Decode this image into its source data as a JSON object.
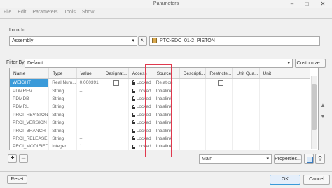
{
  "window": {
    "title": "Parameters",
    "minimize": "–",
    "maximize": "□",
    "close": "✕"
  },
  "menu": [
    "File",
    "Edit",
    "Parameters",
    "Tools",
    "Show"
  ],
  "look_in": {
    "label": "Look In",
    "dropdown_value": "Assembly",
    "selected_path": "PTC-EDC_01-2_PISTON"
  },
  "filter": {
    "label": "Filter By",
    "value": "Default",
    "customize_label": "Customize..."
  },
  "table": {
    "columns": [
      "Name",
      "Type",
      "Value",
      "Designat...",
      "Access",
      "Source",
      "Descripti...",
      "Restricte...",
      "Unit Qua...",
      "Unit"
    ],
    "rows": [
      {
        "name": "WEIGHT",
        "type": "Real Num...",
        "value": "0.000391",
        "access": "Locked",
        "source": "Relation",
        "selected": true
      },
      {
        "name": "PDMREV",
        "type": "String",
        "value": "–",
        "access": "Locked",
        "source": "Intralink"
      },
      {
        "name": "PDMDB",
        "type": "String",
        "value": "",
        "access": "Locked",
        "source": "Intralink"
      },
      {
        "name": "PDMRL",
        "type": "String",
        "value": "",
        "access": "Locked",
        "source": "Intralink"
      },
      {
        "name": "PROI_REVISION",
        "type": "String",
        "value": "",
        "access": "Locked",
        "source": "Intralink"
      },
      {
        "name": "PROI_VERSION",
        "type": "String",
        "value": "+",
        "access": "Locked",
        "source": "Intralink"
      },
      {
        "name": "PROI_BRANCH",
        "type": "String",
        "value": "",
        "access": "Locked",
        "source": "Intralink"
      },
      {
        "name": "PROI_RELEASE",
        "type": "String",
        "value": "–",
        "access": "Locked",
        "source": "Intralink"
      },
      {
        "name": "PROI_MODIFIED",
        "type": "Integer",
        "value": "1",
        "access": "Locked",
        "source": "Intralink"
      }
    ]
  },
  "bottom": {
    "add": "+",
    "remove": "–",
    "main_value": "Main",
    "properties_label": "Properties..."
  },
  "footer": {
    "reset": "Reset",
    "ok": "OK",
    "cancel": "Cancel"
  },
  "colors": {
    "accent": "#3a9ad9",
    "highlight_box": "#e0394e"
  }
}
